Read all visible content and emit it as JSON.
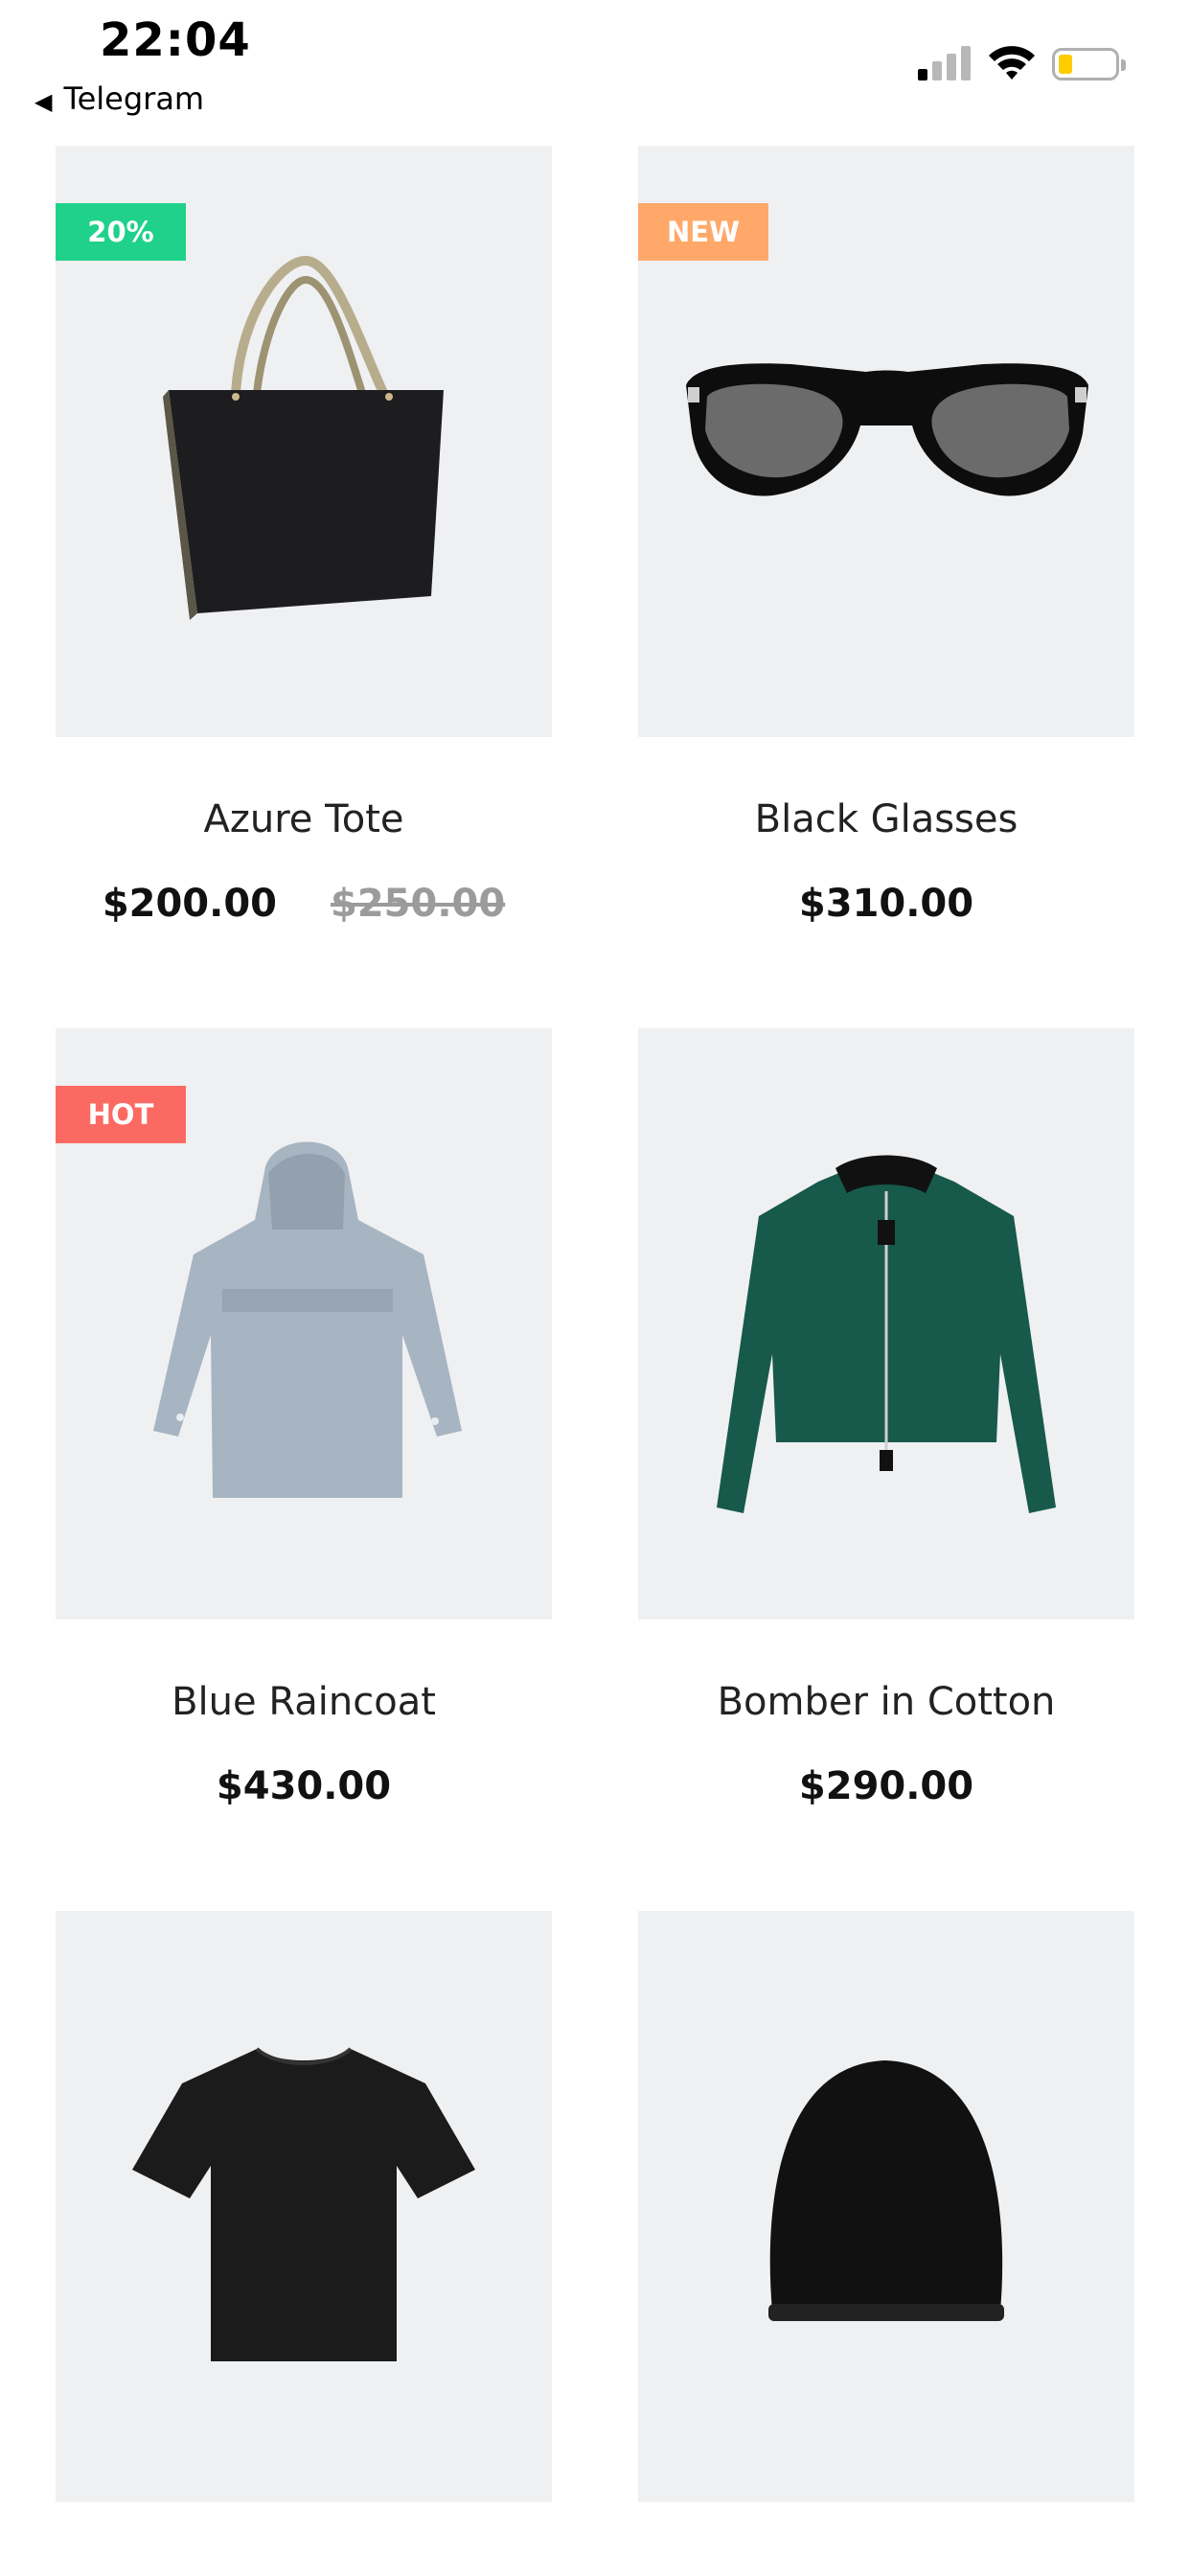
{
  "status_bar": {
    "time": "22:04",
    "back_label": "Telegram",
    "icons": [
      "cellular-signal-icon",
      "wifi-icon",
      "battery-icon"
    ]
  },
  "colors": {
    "badge_sale": "#1fd18a",
    "badge_new": "#ffa86a",
    "badge_hot": "#fb6a62",
    "image_bg": "#eff0f2"
  },
  "products": [
    {
      "name": "Azure Tote",
      "price": "$200.00",
      "old_price": "$250.00",
      "badge": "20%",
      "image": "tote-bag-image"
    },
    {
      "name": "Black Glasses",
      "price": "$310.00",
      "badge": "NEW",
      "image": "sunglasses-image"
    },
    {
      "name": "Blue Raincoat",
      "price": "$430.00",
      "badge": "HOT",
      "image": "raincoat-image"
    },
    {
      "name": "Bomber in Cotton",
      "price": "$290.00",
      "image": "bomber-jacket-image"
    },
    {
      "image": "t-shirt-image"
    },
    {
      "image": "beanie-image"
    }
  ]
}
